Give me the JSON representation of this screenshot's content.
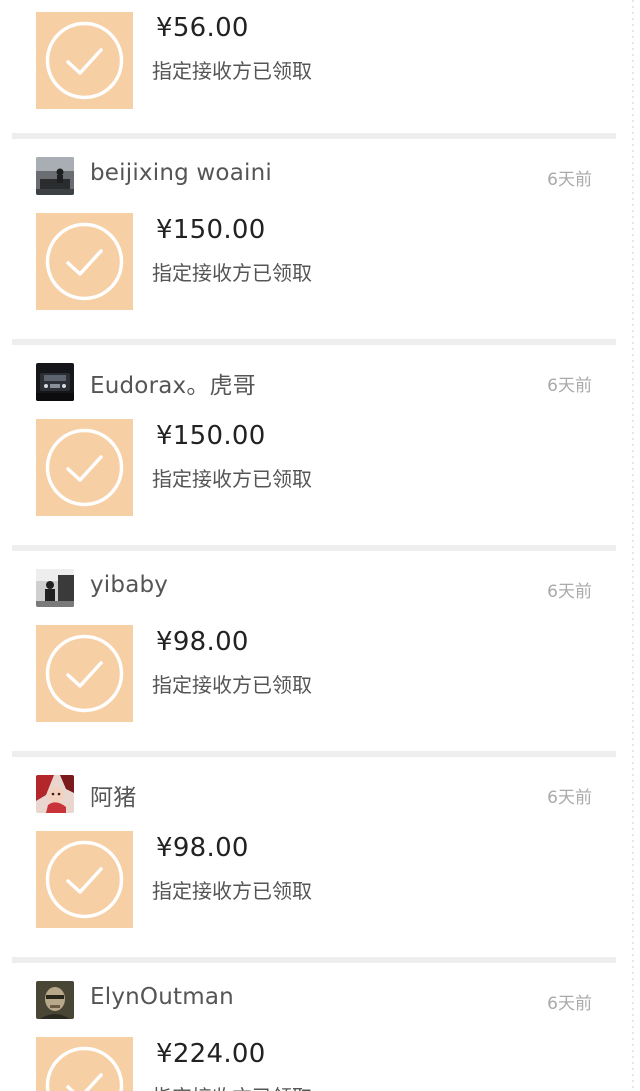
{
  "feed": {
    "items": [
      {
        "user": "",
        "time": "",
        "amount": "¥56.00",
        "status": "指定接收方已领取",
        "avatar": "none"
      },
      {
        "user": "beijixing woaini",
        "time": "6天前",
        "amount": "¥150.00",
        "status": "指定接收方已领取",
        "avatar": "avatar-piano-photo"
      },
      {
        "user": "Eudorax。虎哥",
        "time": "6天前",
        "amount": "¥150.00",
        "status": "指定接收方已领取",
        "avatar": "avatar-car-photo"
      },
      {
        "user": "yibaby",
        "time": "6天前",
        "amount": "¥98.00",
        "status": "指定接收方已领取",
        "avatar": "avatar-street-photo"
      },
      {
        "user": "阿猪",
        "time": "6天前",
        "amount": "¥98.00",
        "status": "指定接收方已领取",
        "avatar": "avatar-illustration"
      },
      {
        "user": "ElynOutman",
        "time": "6天前",
        "amount": "¥224.00",
        "status": "指定接收方已领取",
        "avatar": "avatar-portrait-photo"
      }
    ]
  },
  "colors": {
    "envelope": "#f7cfa4",
    "envelope_mark": "#ffffff",
    "separator": "#eeeeee",
    "username": "#555555",
    "time": "#aaaaaa",
    "amount": "#222222"
  },
  "icons": {
    "envelope": "check-circle-icon"
  }
}
